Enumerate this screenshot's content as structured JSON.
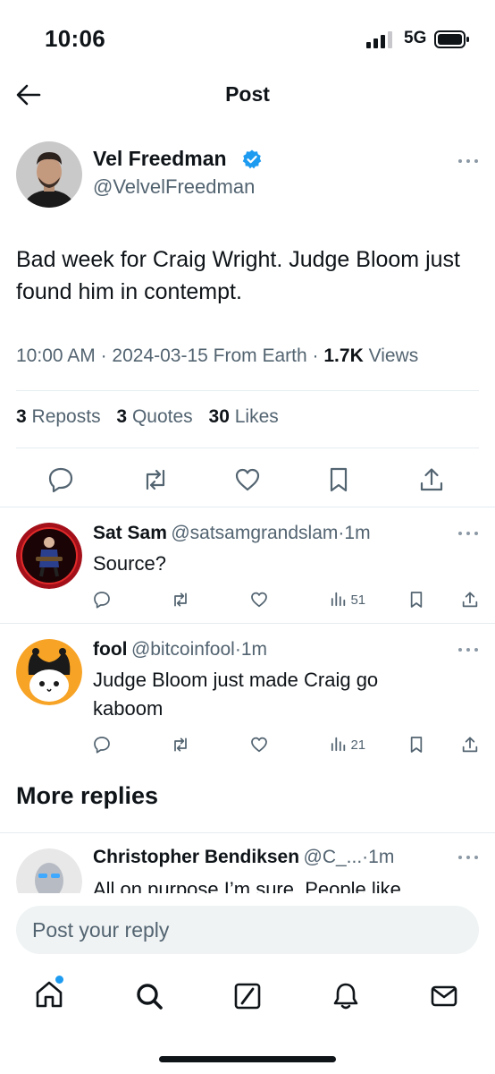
{
  "status_bar": {
    "time": "10:06",
    "network": "5G"
  },
  "header": {
    "title": "Post"
  },
  "post": {
    "author_name": "Vel Freedman",
    "author_handle": "@VelvelFreedman",
    "text": "Bad week for Craig Wright. Judge Bloom just found him in contempt.",
    "time": "10:00 AM",
    "date": "2024-03-15",
    "source": "From Earth",
    "views_count": "1.7K",
    "views_label": "Views",
    "reposts_count": "3",
    "reposts_label": "Reposts",
    "quotes_count": "3",
    "quotes_label": "Quotes",
    "likes_count": "30",
    "likes_label": "Likes"
  },
  "replies": [
    {
      "name": "Sat Sam",
      "handle": "@satsamgrandslam",
      "age": "1m",
      "text": "Source?",
      "views": "51"
    },
    {
      "name": "fool",
      "handle": "@bitcoinfool",
      "age": "1m",
      "text": "Judge Bloom just made Craig go kaboom",
      "views": "21"
    }
  ],
  "more_replies": {
    "heading": "More replies",
    "items": [
      {
        "name": "Christopher Bendiksen",
        "handle": "@C_...",
        "age": "1m",
        "text": "All on purpose I’m sure. People like"
      }
    ]
  },
  "reply_box": {
    "placeholder": "Post your reply"
  },
  "icons": {
    "back": "back-arrow-icon",
    "verified": "verified-badge-icon",
    "more": "more-options-icon",
    "reply": "reply-icon",
    "repost": "repost-icon",
    "like": "like-icon",
    "bookmark": "bookmark-icon",
    "share": "share-icon",
    "views": "views-icon",
    "home": "home-icon",
    "search": "search-icon",
    "grok": "grok-icon",
    "notifications": "notifications-icon",
    "messages": "messages-icon"
  },
  "colors": {
    "accent": "#1d9bf0",
    "text": "#0f1419",
    "secondary": "#536471",
    "divider": "#e6ecf0"
  }
}
